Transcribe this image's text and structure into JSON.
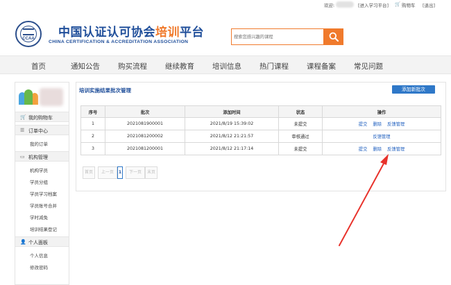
{
  "topbar": {
    "welcome": "欢迎:",
    "enter_platform": "[进入学习平台]",
    "cart": "购物车",
    "logout": "[退出]"
  },
  "header": {
    "site_name_part1": "中国认证认可协会",
    "site_name_accent": "培训",
    "site_name_part2": "平台",
    "site_name_en": "CHINA CERTIFICATION & ACCREDITATION ASSOCIATION",
    "logo_text": "CCAA",
    "search_placeholder": "搜索您感兴趣的课程"
  },
  "nav": [
    "首页",
    "通知公告",
    "购买流程",
    "继续教育",
    "培训信息",
    "热门课程",
    "课程备案",
    "常见问题"
  ],
  "sidebar": {
    "sections": [
      {
        "label": "我的购物车",
        "items": []
      },
      {
        "label": "订单中心",
        "items": [
          "我的订单"
        ]
      },
      {
        "label": "机构管理",
        "items": [
          "机构学员",
          "学员分组",
          "学员学习档案",
          "学员账号合并",
          "学时减免",
          "培训结果登记"
        ]
      },
      {
        "label": "个人面板",
        "items": [
          "个人信息",
          "修改密码"
        ]
      }
    ]
  },
  "main": {
    "title": "培训实施结果批次管理",
    "add_button": "添加新批次",
    "columns": [
      "序号",
      "批次",
      "添加时间",
      "状态",
      "操作"
    ],
    "rows": [
      {
        "no": "1",
        "batch": "2021081900001",
        "time": "2021/8/19 15:39:02",
        "status": "未提交",
        "ops": [
          "提交",
          "删除",
          "反馈管理"
        ]
      },
      {
        "no": "2",
        "batch": "2021081200002",
        "time": "2021/8/12 21:21:57",
        "status": "审核通过",
        "ops": [
          "反馈管理"
        ]
      },
      {
        "no": "3",
        "batch": "2021081200001",
        "time": "2021/8/12 21:17:14",
        "status": "未提交",
        "ops": [
          "提交",
          "删除",
          "反馈管理"
        ]
      }
    ],
    "pager": {
      "first": "首页",
      "prev": "上一页",
      "current": "1",
      "next": "下一页",
      "last": "末页"
    }
  },
  "colors": {
    "brand_blue": "#1f4e9a",
    "accent_orange": "#f07a2c",
    "button_blue": "#2f78c8",
    "arrow_red": "#e8322b"
  }
}
